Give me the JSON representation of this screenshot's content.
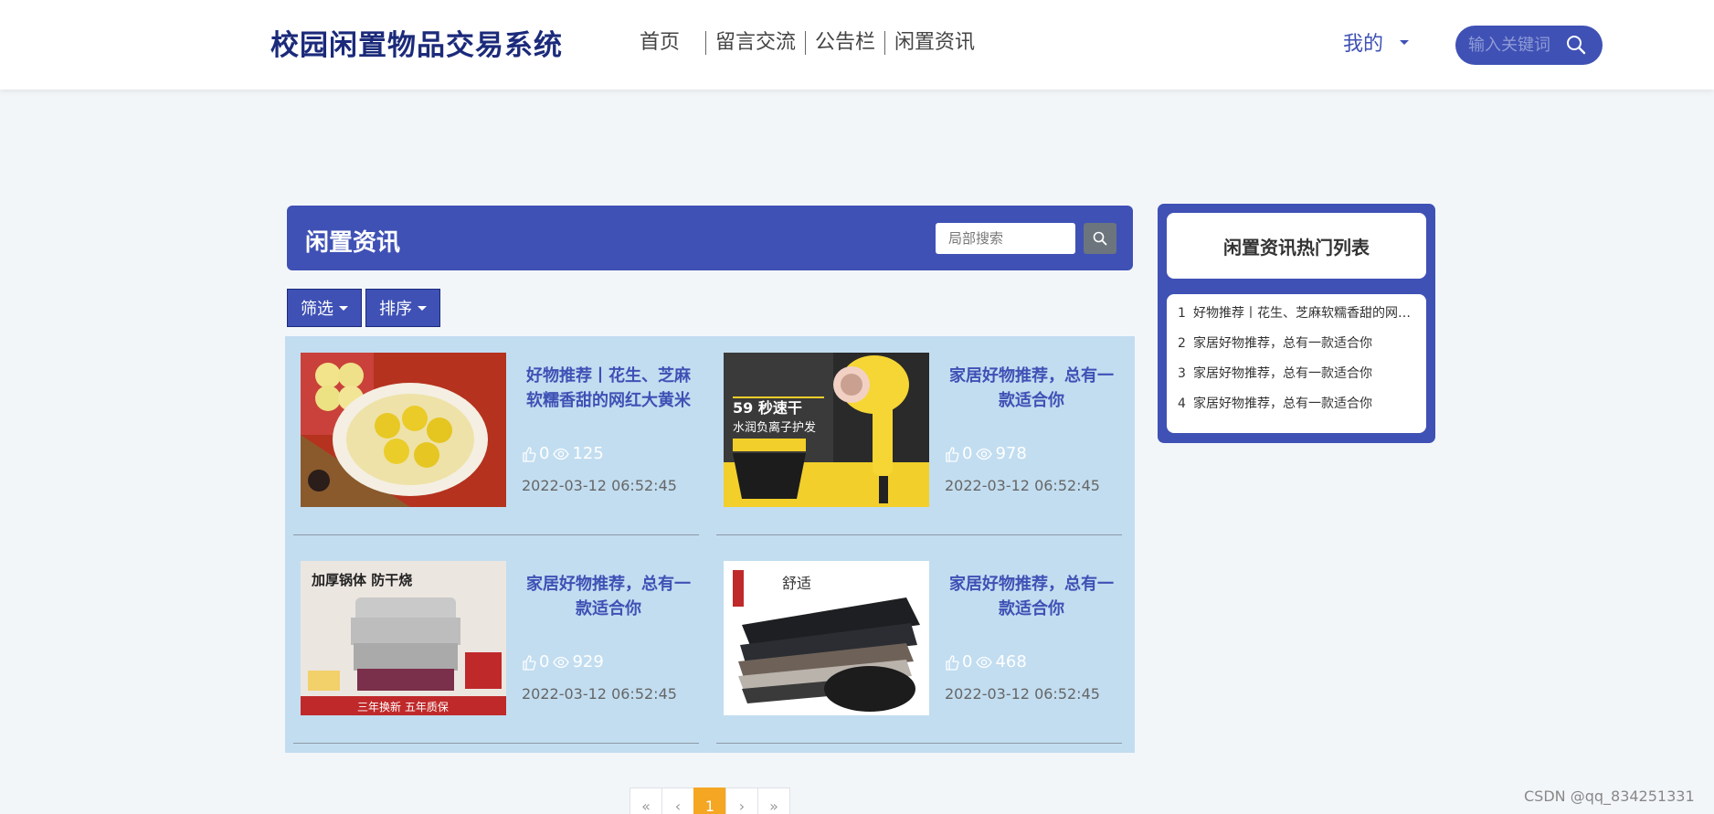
{
  "brand": "校园闲置物品交易系统",
  "nav": [
    {
      "label": "首页"
    },
    {
      "label": "留言交流"
    },
    {
      "label": "公告栏"
    },
    {
      "label": "闲置资讯"
    }
  ],
  "user_menu_label": "我的",
  "top_search_placeholder": "输入关键词",
  "panel": {
    "title": "闲置资讯",
    "search_placeholder": "局部搜索",
    "filter_label": "筛选",
    "sort_label": "排序"
  },
  "cards": [
    {
      "title": "好物推荐丨花生、芝麻软糯香甜的网红大黄米汤圆",
      "likes": "0",
      "views": "125",
      "date": "2022-03-12 06:52:45",
      "image": "tangyuan-photo"
    },
    {
      "title": "家居好物推荐，总有一款适合你",
      "likes": "0",
      "views": "978",
      "date": "2022-03-12 06:52:45",
      "image": "hair-dryer-photo"
    },
    {
      "title": "家居好物推荐，总有一款适合你",
      "likes": "0",
      "views": "929",
      "date": "2022-03-12 06:52:45",
      "image": "steamer-pot-photo"
    },
    {
      "title": "家居好物推荐，总有一款适合你",
      "likes": "0",
      "views": "468",
      "date": "2022-03-12 06:52:45",
      "image": "socks-photo"
    }
  ],
  "image_text": {
    "dryer_badge": "59 秒速干",
    "dryer_sub": "水润负离子护发",
    "steamer_head": "加厚锅体 防干烧",
    "steamer_foot": "三年换新 五年质保",
    "socks_tag": "舒适"
  },
  "pager": [
    "«",
    "‹",
    "1",
    "›",
    "»"
  ],
  "hot_list": {
    "title": "闲置资讯热门列表",
    "items": [
      {
        "num": "1",
        "text": "好物推荐丨花生、芝麻软糯香甜的网红大黄米汤圆"
      },
      {
        "num": "2",
        "text": "家居好物推荐，总有一款适合你"
      },
      {
        "num": "3",
        "text": "家居好物推荐，总有一款适合你"
      },
      {
        "num": "4",
        "text": "家居好物推荐，总有一款适合你"
      }
    ]
  },
  "watermark": "CSDN @qq_834251331",
  "colors": {
    "primary": "#3f51b5",
    "brand": "#1b2a7a",
    "grid_bg": "#c2ddf0",
    "active_page": "#f5a623"
  }
}
